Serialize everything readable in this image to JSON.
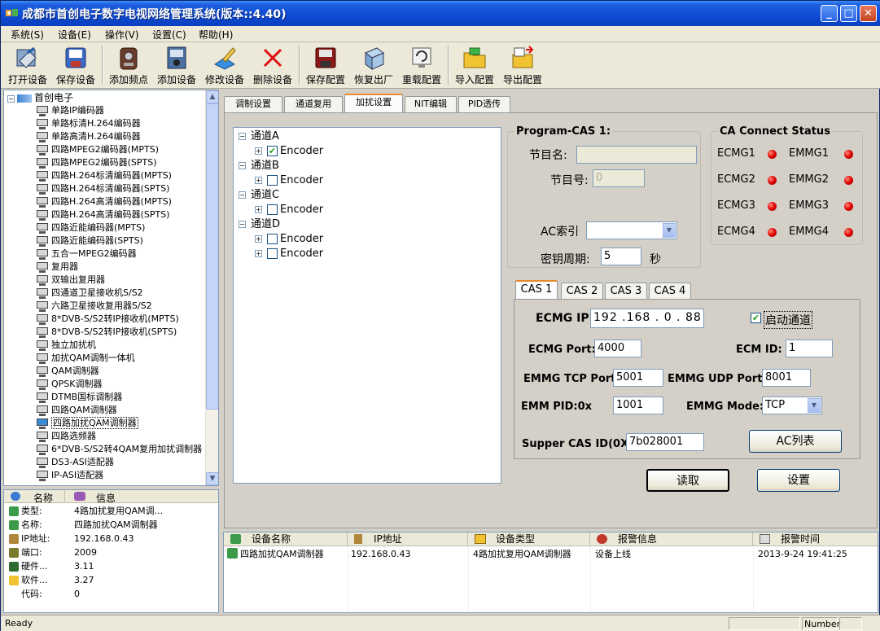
{
  "window": {
    "title": "成都市首创电子数字电视网络管理系统(版本::4.40)"
  },
  "menu": [
    "系统(S)",
    "设备(E)",
    "操作(V)",
    "设置(C)",
    "帮助(H)"
  ],
  "toolbar": [
    "打开设备",
    "保存设备",
    "添加频点",
    "添加设备",
    "修改设备",
    "删除设备",
    "保存配置",
    "恢复出厂",
    "重载配置",
    "导入配置",
    "导出配置"
  ],
  "tree": {
    "root": "首创电子",
    "items": [
      "单路IP编码器",
      "单路标清H.264编码器",
      "单路高清H.264编码器",
      "四路MPEG2编码器(MPTS)",
      "四路MPEG2编码器(SPTS)",
      "四路H.264标清编码器(MPTS)",
      "四路H.264标清编码器(SPTS)",
      "四路H.264高清编码器(MPTS)",
      "四路H.264高清编码器(SPTS)",
      "四路近能编码器(MPTS)",
      "四路近能编码器(SPTS)",
      "五合一MPEG2编码器",
      "复用器",
      "双输出复用器",
      "四通道卫星接收机S/S2",
      "六路卫星接收复用器S/S2",
      "8*DVB-S/S2转IP接收机(MPTS)",
      "8*DVB-S/S2转IP接收机(SPTS)",
      "独立加扰机",
      "加扰QAM调制一体机",
      "QAM调制器",
      "QPSK调制器",
      "DTMB国标调制器",
      "四路QAM调制器",
      "四路加扰QAM调制器",
      "四路选频器",
      "6*DVB-S/S2转4QAM复用加扰调制器",
      "DS3-ASI适配器",
      "IP-ASI适配器"
    ],
    "selected": 24
  },
  "info": {
    "headers": [
      "名称",
      "信息"
    ],
    "rows": [
      {
        "label": "类型:",
        "value": "4路加扰复用QAM调..."
      },
      {
        "label": "名称:",
        "value": "四路加扰QAM调制器"
      },
      {
        "label": "IP地址:",
        "value": "192.168.0.43"
      },
      {
        "label": "端口:",
        "value": "2009"
      },
      {
        "label": "硬件...",
        "value": "3.11"
      },
      {
        "label": "软件...",
        "value": "3.27"
      },
      {
        "label": "代码:",
        "value": "0"
      }
    ]
  },
  "tabs": [
    "调制设置",
    "通道复用",
    "加扰设置",
    "NIT编辑",
    "PID透传"
  ],
  "channels": [
    {
      "name": "通道A",
      "encoders": [
        {
          "label": "Encoder",
          "checked": true
        }
      ]
    },
    {
      "name": "通道B",
      "encoders": [
        {
          "label": "Encoder",
          "checked": false
        }
      ]
    },
    {
      "name": "通道C",
      "encoders": [
        {
          "label": "Encoder",
          "checked": false
        }
      ]
    },
    {
      "name": "通道D",
      "encoders": [
        {
          "label": "Encoder",
          "checked": false
        },
        {
          "label": "Encoder",
          "checked": false
        }
      ]
    }
  ],
  "program_cas": {
    "title": "Program-CAS 1:",
    "prog_name_label": "节目名:",
    "prog_name_value": "",
    "prog_num_label": "节目号:",
    "prog_num_value": "0",
    "ac_label": "AC索引",
    "ac_value": "",
    "key_label": "密钥周期:",
    "key_value": "5",
    "key_unit": "秒"
  },
  "ca_status": {
    "title": "CA Connect Status",
    "rows": [
      [
        "ECMG1",
        "EMMG1"
      ],
      [
        "ECMG2",
        "EMMG2"
      ],
      [
        "ECMG3",
        "EMMG3"
      ],
      [
        "ECMG4",
        "EMMG4"
      ]
    ],
    "led_color": "#e00000"
  },
  "cas_tabs": [
    "CAS 1",
    "CAS 2",
    "CAS 3",
    "CAS 4"
  ],
  "cas": {
    "ecmg_ip_label": "ECMG IP:",
    "ecmg_ip_value": "192 .168 .  0  . 88",
    "enable_label": "启动通道",
    "ecmg_port_label": "ECMG Port:",
    "ecmg_port_value": "4000",
    "ecm_id_label": "ECM ID:",
    "ecm_id_value": "1",
    "emmg_tcp_label": "EMMG TCP Port:",
    "emmg_tcp_value": "5001",
    "emmg_udp_label": "EMMG UDP Port:",
    "emmg_udp_value": "8001",
    "emm_pid_label": "EMM PID:0x",
    "emm_pid_value": "1001",
    "emmg_mode_label": "EMMG Mode:",
    "emmg_mode_value": "TCP",
    "super_cas_label": "Supper CAS ID(0X):",
    "super_cas_value": "7b028001",
    "ac_list_button": "AC列表"
  },
  "buttons": {
    "read": "读取",
    "set": "设置"
  },
  "alarm": {
    "headers": [
      "设备名称",
      "IP地址",
      "设备类型",
      "报警信息",
      "报警时间"
    ],
    "rows": [
      [
        "四路加扰QAM调制器",
        "192.168.0.43",
        "4路加扰复用QAM调制器",
        "设备上线",
        "2013-9-24 19:41:25"
      ]
    ]
  },
  "status": {
    "left": "Ready",
    "right": "Number"
  }
}
